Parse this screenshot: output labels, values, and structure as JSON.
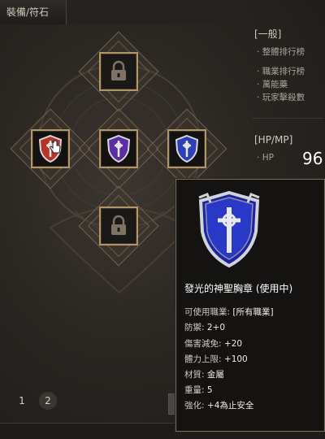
{
  "panel": {
    "title": "裝備/符石"
  },
  "side": {
    "general_title": "[一般]",
    "links": [
      "整體排行榜",
      "職業排行榜",
      "萬能藥",
      "玩家擊殺數"
    ],
    "hpmp_title": "[HP/MP]",
    "hp_label": "HP",
    "hp_value": "96"
  },
  "slots": [
    {
      "name": "top-locked-slot",
      "state": "locked"
    },
    {
      "name": "left-red-shield-slot",
      "state": "equipped",
      "color": "#c0392b"
    },
    {
      "name": "center-purple-shield-slot",
      "state": "equipped",
      "color": "#5b2ea6"
    },
    {
      "name": "right-blue-shield-slot",
      "state": "equipped",
      "color": "#2f3fb8"
    },
    {
      "name": "bottom-locked-slot",
      "state": "locked"
    }
  ],
  "tooltip": {
    "item_name": "發光的神聖胸章 (使用中)",
    "stats": [
      {
        "label": "可使用職業:",
        "value": "[所有職業]"
      },
      {
        "label": "防禦:",
        "value": "2+0"
      },
      {
        "label": "傷害減免:",
        "value": "+20"
      },
      {
        "label": "體力上限:",
        "value": "+100"
      },
      {
        "label": "材質:",
        "value": "金屬"
      },
      {
        "label": "重量:",
        "value": "5"
      },
      {
        "label": "強化:",
        "value": "+4為止安全"
      }
    ]
  },
  "pagination": {
    "pages": [
      "1",
      "2"
    ],
    "current": "2"
  },
  "colors": {
    "frame_gold": "#b39668",
    "tooltip_border": "#7a6a55"
  }
}
